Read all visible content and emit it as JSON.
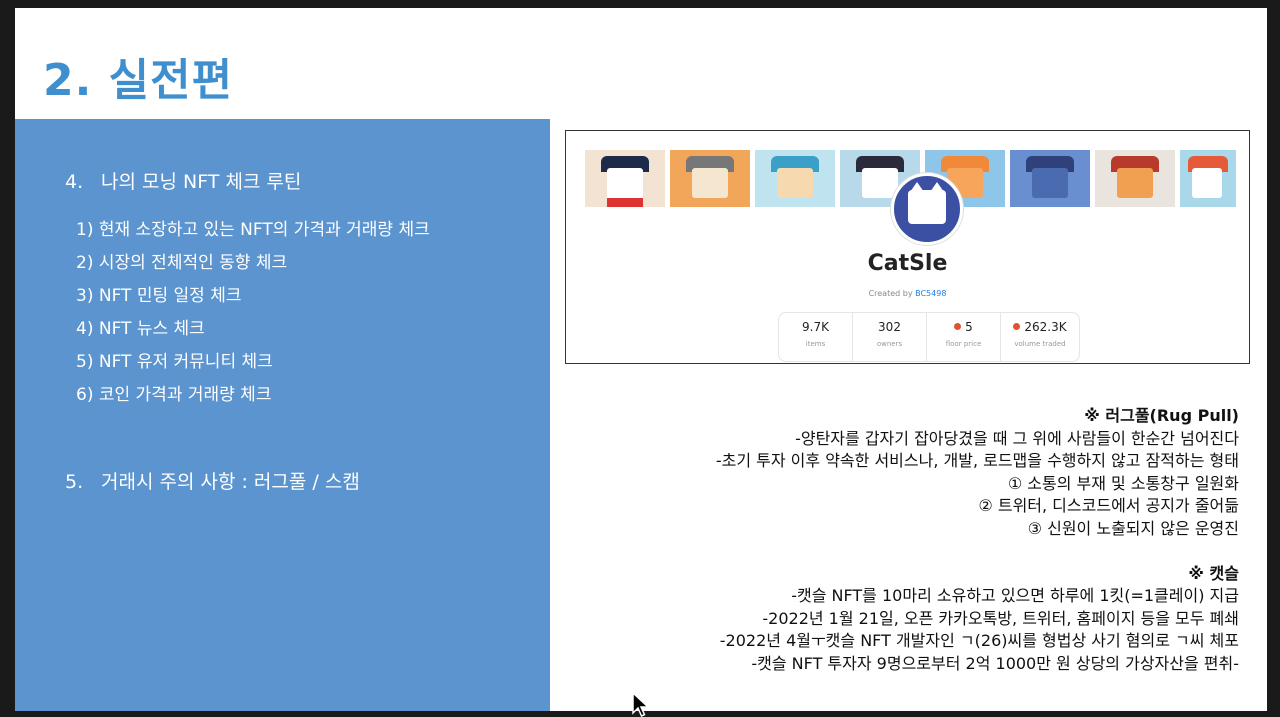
{
  "slide": {
    "title": "2. 실전편",
    "section4": {
      "number": "4.",
      "title": "나의 모닝 NFT 체크 루틴"
    },
    "routine": [
      "1) 현재 소장하고 있는 NFT의 가격과 거래량 체크",
      "2) 시장의 전체적인 동향 체크",
      "3) NFT 민팅 일정 체크",
      "4) NFT 뉴스 체크",
      "5) NFT 유저 커뮤니티 체크",
      "6) 코인 가격과 거래량 체크"
    ],
    "section5": {
      "number": "5.",
      "title": "거래시 주의 사항 : 러그풀 / 스캠"
    },
    "nft_card": {
      "name": "CatSle",
      "created_by_label": "Created by",
      "creator": "BC5498",
      "stats": [
        {
          "value": "9.7K",
          "label": "items",
          "icon": ""
        },
        {
          "value": "302",
          "label": "owners",
          "icon": ""
        },
        {
          "value": "5",
          "label": "floor price",
          "icon": "eth-icon"
        },
        {
          "value": "262.3K",
          "label": "volume traded",
          "icon": "eth-icon"
        }
      ]
    },
    "rugpull": {
      "heading": "※ 러그풀(Rug Pull)",
      "lines": [
        "-양탄자를 갑자기 잡아당겼을 때 그 위에 사람들이 한순간 넘어진다",
        "-초기 투자 이후 약속한 서비스나, 개발, 로드맵을 수행하지 않고 잠적하는 형태",
        "① 소통의 부재 및 소통창구 일원화",
        "② 트위터, 디스코드에서 공지가 줄어듦",
        "③ 신원이 노출되지 않은 운영진"
      ]
    },
    "catsle": {
      "heading": "※ 캣슬",
      "lines": [
        "-캣슬 NFT를 10마리 소유하고 있으면 하루에 1킷(=1클레이) 지급",
        "-2022년 1월 21일, 오픈 카카오톡방, 트위터, 홈페이지 등을 모두 폐쇄",
        "-2022년 4월ㅜ캣슬 NFT 개발자인 ㄱ(26)씨를 형법상 사기 혐의로 ㄱ씨 체포",
        "-캣슬 NFT 투자자 9명으로부터 2억 1000만 원 상당의 가상자산을 편취-"
      ]
    }
  },
  "colors": {
    "title_blue": "#3f8fcf",
    "panel_blue": "#5b94cf",
    "link_blue": "#2081e2"
  }
}
